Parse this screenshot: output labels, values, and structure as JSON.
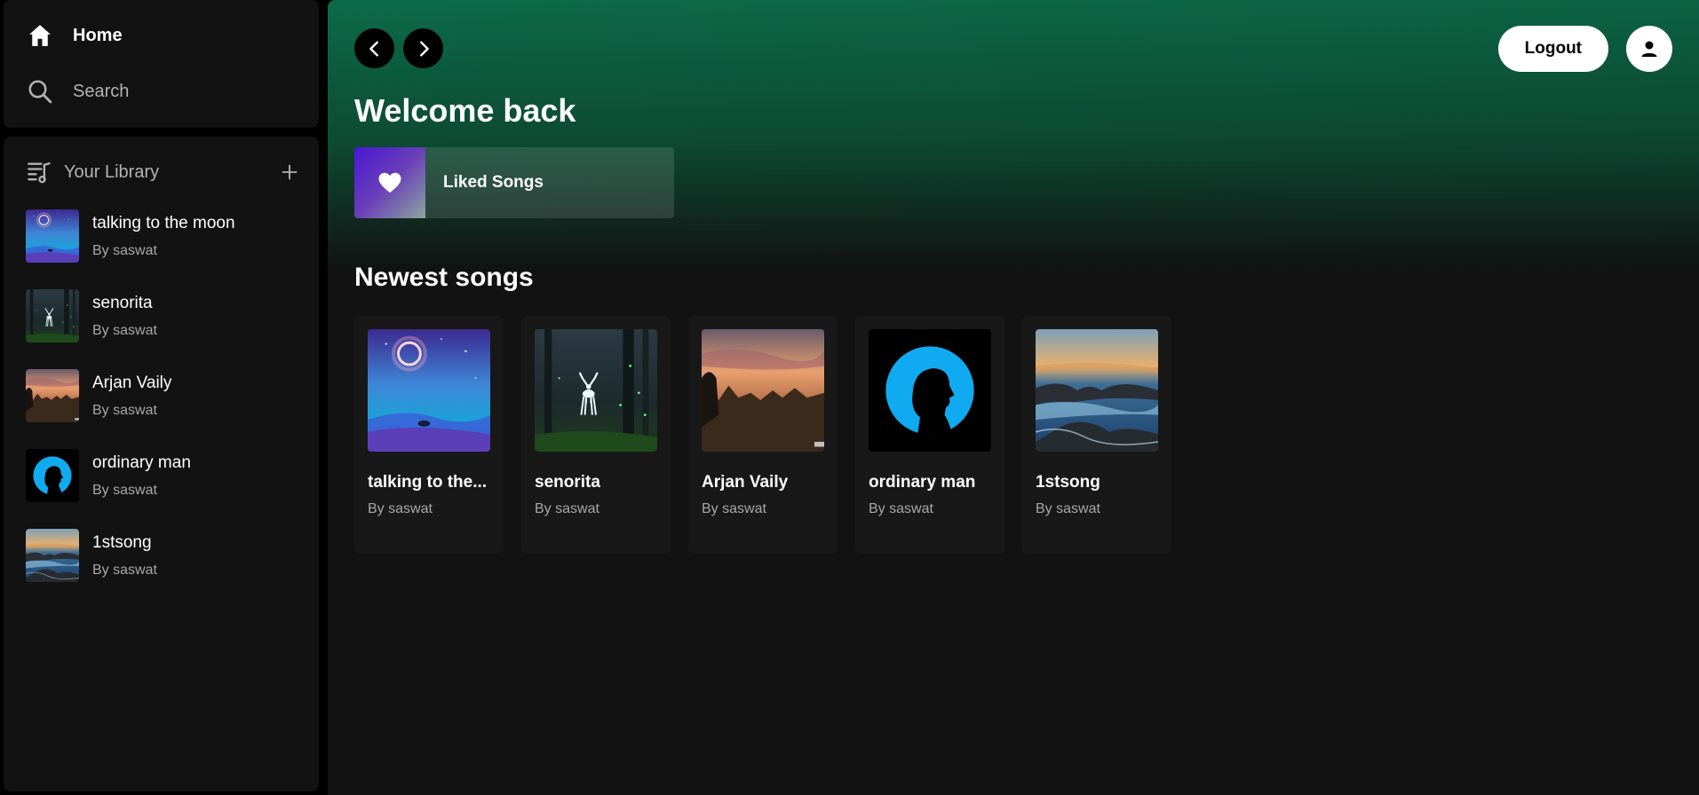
{
  "nav": {
    "home_label": "Home",
    "search_label": "Search"
  },
  "library": {
    "title": "Your Library",
    "items": [
      {
        "title": "talking to the moon",
        "subtitle": "By saswat",
        "art": "moon"
      },
      {
        "title": "senorita",
        "subtitle": "By saswat",
        "art": "deer"
      },
      {
        "title": "Arjan Vaily",
        "subtitle": "By saswat",
        "art": "sunset"
      },
      {
        "title": "ordinary man",
        "subtitle": "By saswat",
        "art": "silhouette"
      },
      {
        "title": "1stsong",
        "subtitle": "By saswat",
        "art": "ocean"
      }
    ]
  },
  "header": {
    "logout_label": "Logout"
  },
  "main": {
    "welcome": "Welcome back",
    "liked_label": "Liked Songs",
    "section_title": "Newest songs",
    "cards": [
      {
        "title": "talking to the...",
        "subtitle": "By saswat",
        "art": "moon"
      },
      {
        "title": "senorita",
        "subtitle": "By saswat",
        "art": "deer"
      },
      {
        "title": "Arjan Vaily",
        "subtitle": "By saswat",
        "art": "sunset"
      },
      {
        "title": "ordinary man",
        "subtitle": "By saswat",
        "art": "silhouette"
      },
      {
        "title": "1stsong",
        "subtitle": "By saswat",
        "art": "ocean"
      }
    ]
  },
  "colors": {
    "accent_green": "#0c6b4a",
    "panel": "#121212",
    "card": "#181818",
    "silhouette_blue": "#10aaf0"
  },
  "icons": [
    "home-icon",
    "search-icon",
    "library-icon",
    "plus-icon",
    "chevron-left-icon",
    "chevron-right-icon",
    "user-icon",
    "heart-icon"
  ]
}
